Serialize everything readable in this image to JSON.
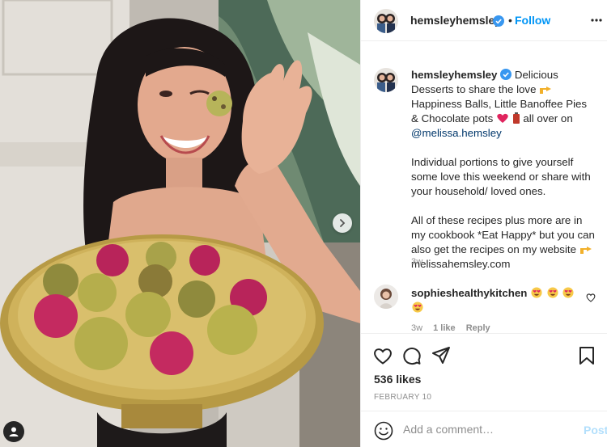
{
  "post": {
    "account": {
      "username": "hemsleyhemsley",
      "verified": true,
      "follow_separator": "•",
      "follow_label": "Follow",
      "more_icon": "more-horizontal-icon"
    },
    "caption": {
      "username": "hemsleyhemsley",
      "line1_a": "Delicious Desserts to share the love",
      "line1_b": "Happiness Balls, Little Banoffee Pies & Chocolate pots",
      "line1_c": "all over on",
      "mention": "@melissa.hemsley",
      "para2": "Individual portions to give yourself some love this weekend or share with your household/ loved ones.",
      "para3": "All of these recipes plus more are in my cookbook *Eat Happy* but you can also get the recipes on my website",
      "website": "melissahemsley.com",
      "time": "3w"
    },
    "comment": {
      "username": "sophieshealthykitchen",
      "emoji": [
        "heart-eyes",
        "heart-eyes",
        "heart-eyes",
        "heart-eyes"
      ],
      "time": "3w",
      "likes": "1 like",
      "reply": "Reply"
    },
    "actions": {
      "icons": [
        "heart-icon",
        "comment-icon",
        "share-icon",
        "bookmark-icon"
      ],
      "likes": "536 likes",
      "date": "FEBRUARY 10"
    },
    "add_comment": {
      "placeholder": "Add a comment…",
      "post_label": "Post"
    },
    "colors": {
      "link": "#0095f6",
      "mention": "#00376b",
      "muted": "#8e8e8e",
      "post_disabled": "#b2dffc",
      "verified": "#3897f0"
    }
  }
}
